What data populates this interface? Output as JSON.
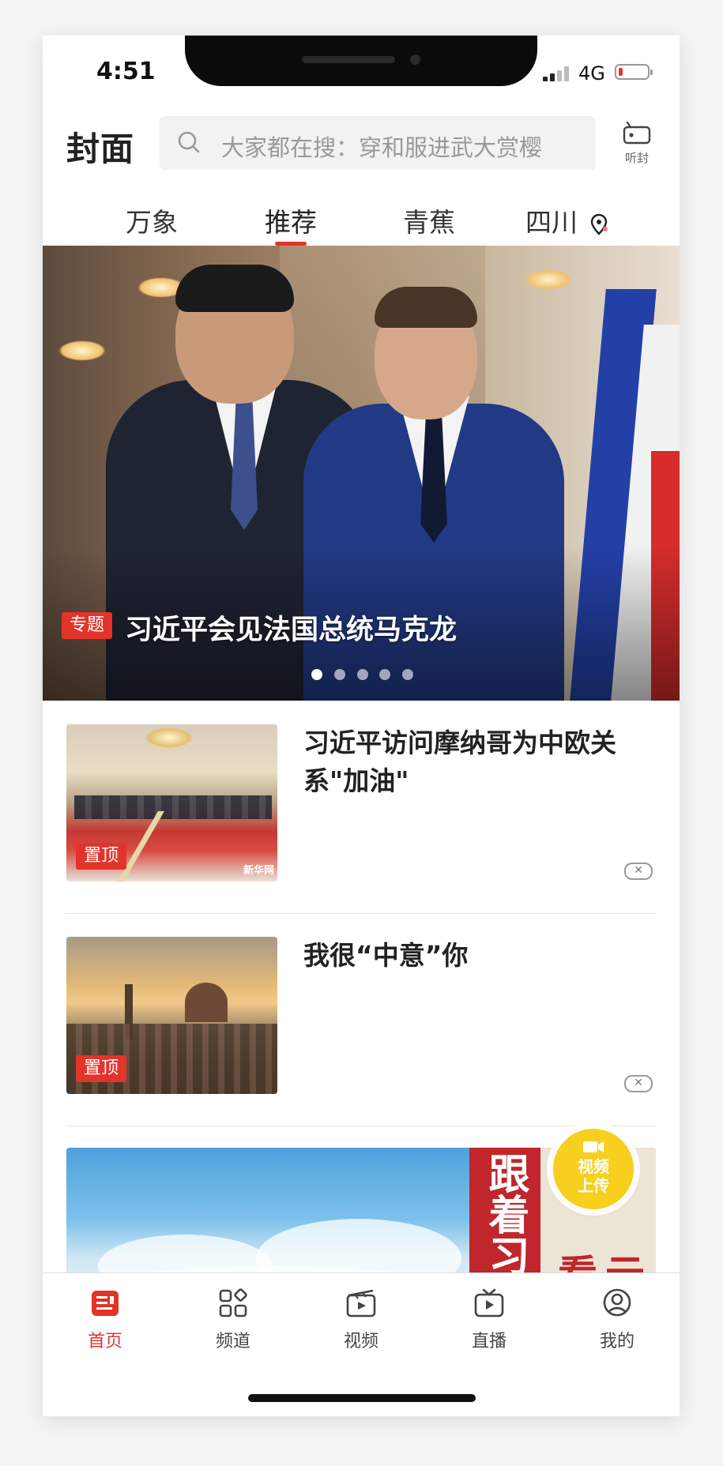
{
  "status_bar": {
    "time": "4:51",
    "network": "4G"
  },
  "header": {
    "logo": "封面",
    "search_placeholder": "大家都在搜：穿和服进武大赏樱",
    "listen_label": "听封"
  },
  "tabs": [
    {
      "label": "万象",
      "active": false
    },
    {
      "label": "推荐",
      "active": true
    },
    {
      "label": "青蕉",
      "active": false
    },
    {
      "label": "四川",
      "active": false
    }
  ],
  "banner": {
    "tag": "专题",
    "title": "习近平会见法国总统马克龙",
    "dot_count": 5,
    "active_dot": 0
  },
  "news_items": [
    {
      "title": "习近平访问摩纳哥为中欧关系\"加油\"",
      "tag": "置顶",
      "thumb_watermark": "新华网"
    },
    {
      "title": "我很“中意”你",
      "tag": "置顶"
    }
  ],
  "feature_card": {
    "band_text": "跟着习",
    "paper_text": "云看"
  },
  "upload_button": {
    "label_line1": "视频",
    "label_line2": "上传"
  },
  "bottom_nav": [
    {
      "label": "首页",
      "icon": "home-news-icon",
      "active": true
    },
    {
      "label": "频道",
      "icon": "channels-grid-icon",
      "active": false
    },
    {
      "label": "视频",
      "icon": "video-clapper-icon",
      "active": false
    },
    {
      "label": "直播",
      "icon": "live-tv-icon",
      "active": false
    },
    {
      "label": "我的",
      "icon": "profile-icon",
      "active": false
    }
  ],
  "colors": {
    "accent": "#e2342a",
    "upload": "#f7cf1e"
  }
}
